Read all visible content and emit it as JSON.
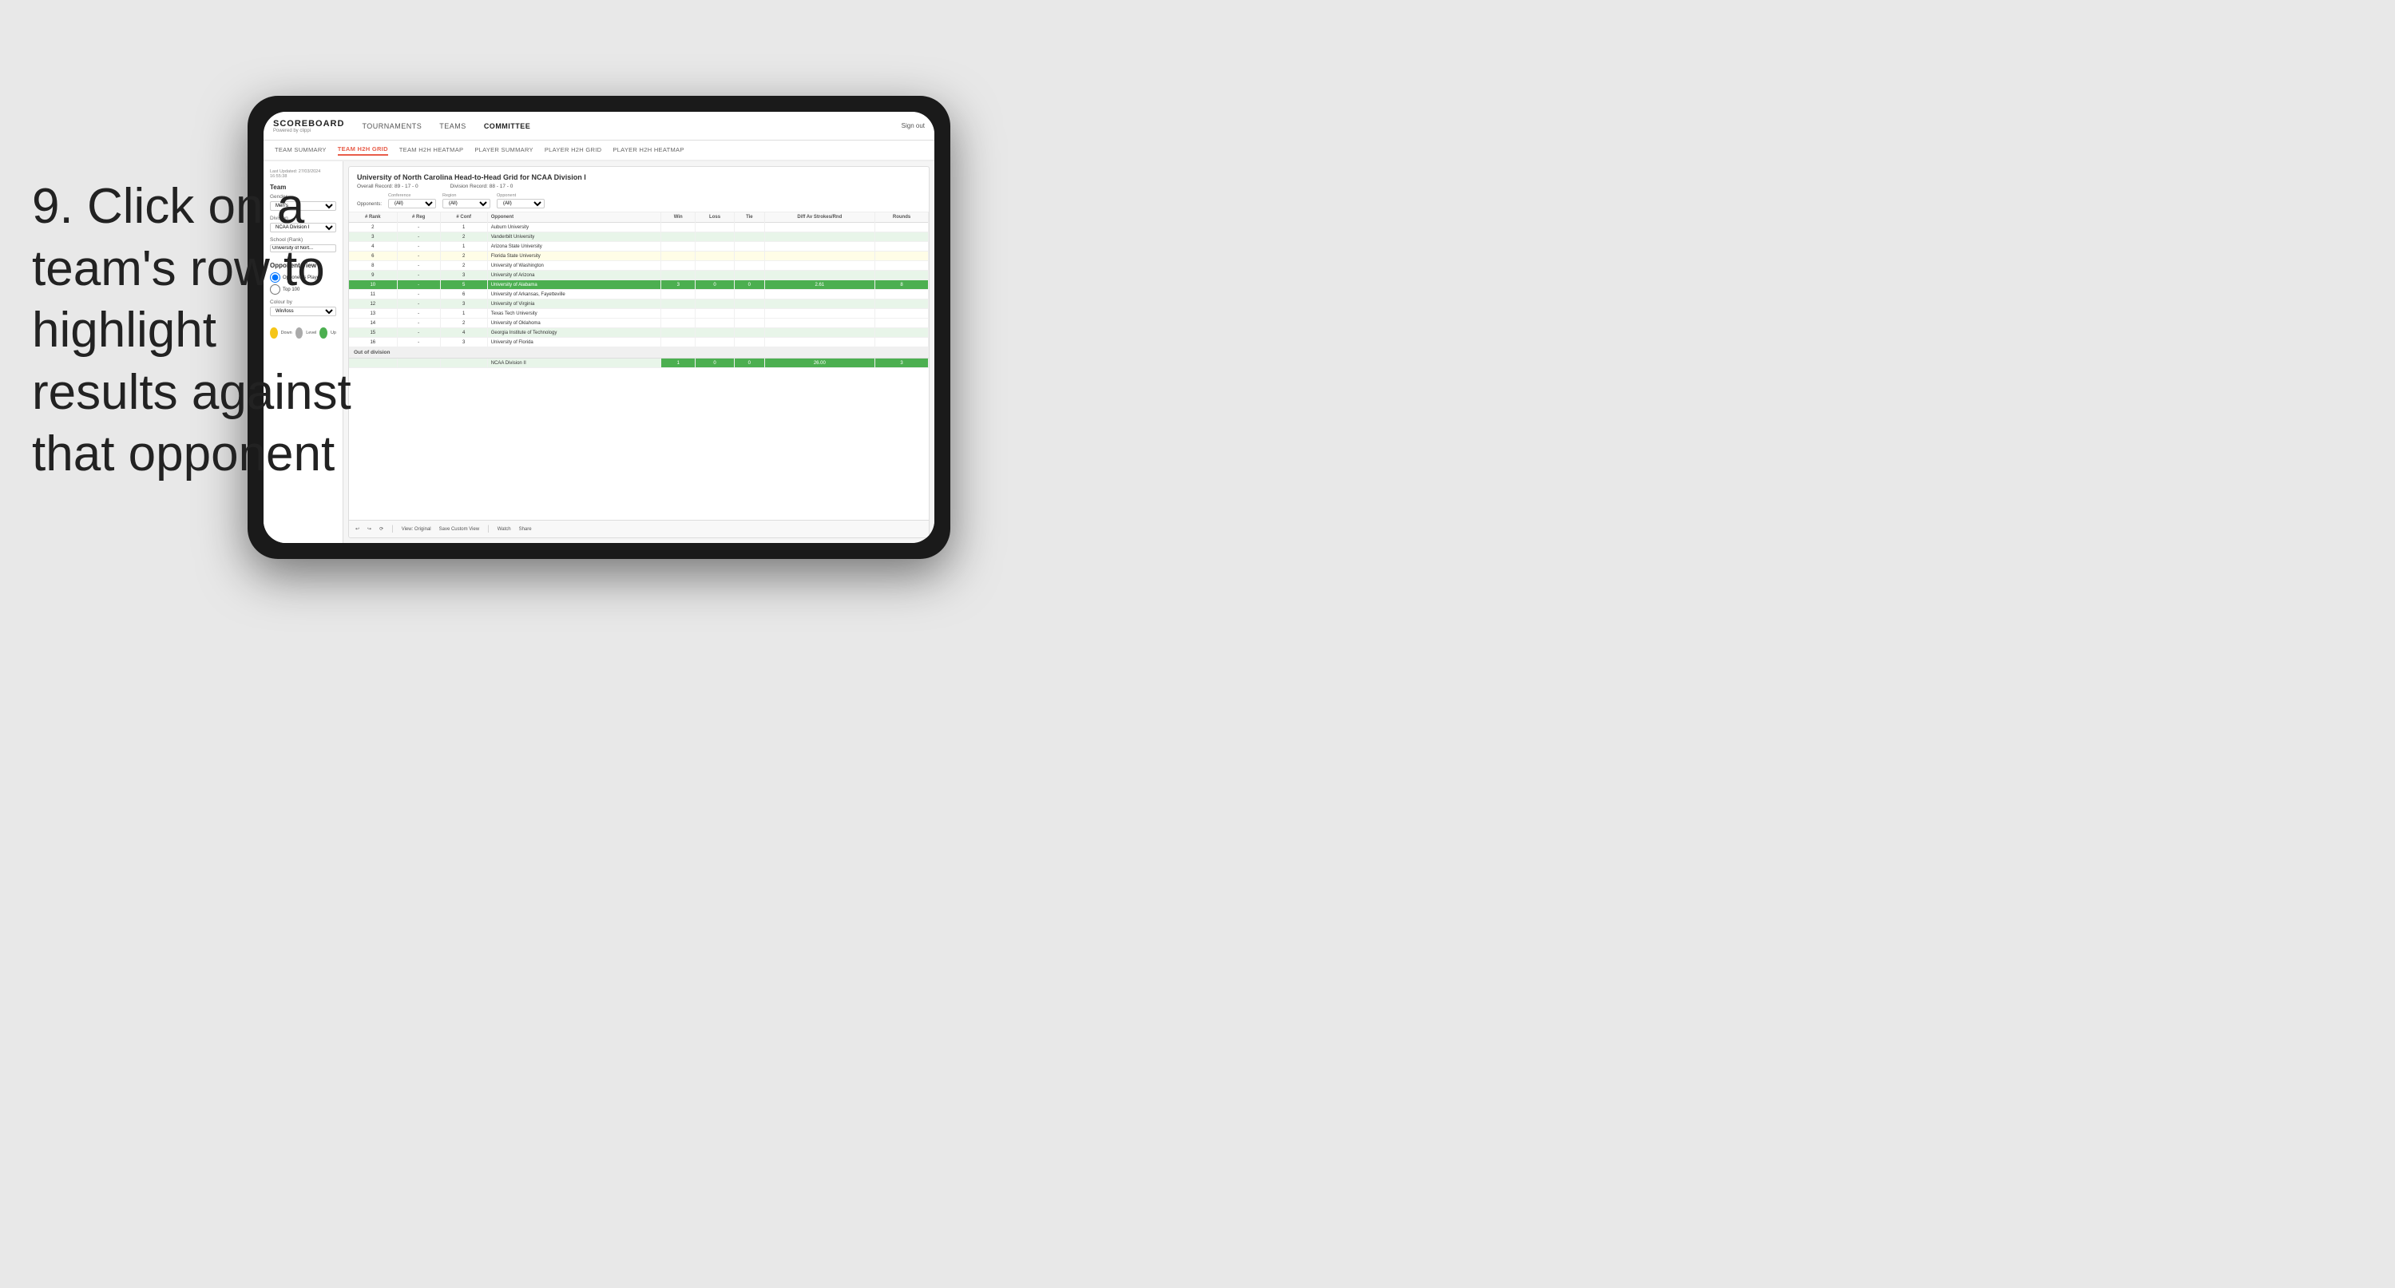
{
  "instruction": {
    "step": "9.",
    "text": "Click on a team's row to highlight results against that opponent"
  },
  "nav": {
    "logo": "SCOREBOARD",
    "logo_sub": "Powered by clippi",
    "items": [
      "TOURNAMENTS",
      "TEAMS",
      "COMMITTEE"
    ],
    "sign_out": "Sign out"
  },
  "sub_nav": {
    "items": [
      "TEAM SUMMARY",
      "TEAM H2H GRID",
      "TEAM H2H HEATMAP",
      "PLAYER SUMMARY",
      "PLAYER H2H GRID",
      "PLAYER H2H HEATMAP"
    ],
    "active": "TEAM H2H GRID"
  },
  "sidebar": {
    "last_updated_label": "Last Updated: 27/03/2024",
    "last_updated_time": "16:55:38",
    "team_label": "Team",
    "gender_label": "Gender",
    "gender_value": "Men's",
    "division_label": "Division",
    "division_value": "NCAA Division I",
    "school_label": "School (Rank)",
    "school_value": "University of Nort...",
    "opponent_view_label": "Opponent View",
    "radio_opponents": "Opponents Played",
    "radio_top100": "Top 100",
    "colour_by_label": "Colour by",
    "colour_value": "Win/loss",
    "legend_down": "Down",
    "legend_level": "Level",
    "legend_up": "Up"
  },
  "table": {
    "title": "University of North Carolina Head-to-Head Grid for NCAA Division I",
    "overall_record_label": "Overall Record:",
    "overall_record": "89 - 17 - 0",
    "division_record_label": "Division Record:",
    "division_record": "88 - 17 - 0",
    "filter_opponents_label": "Opponents:",
    "filter_conference_label": "Conference",
    "filter_conference_value": "(All)",
    "filter_region_label": "Region",
    "filter_region_value": "(All)",
    "filter_opponent_label": "Opponent",
    "filter_opponent_value": "(All)",
    "columns": {
      "rank": "# Rank",
      "reg": "# Reg",
      "conf": "# Conf",
      "opponent": "Opponent",
      "win": "Win",
      "loss": "Loss",
      "tie": "Tie",
      "diff_av": "Diff Av Strokes/Rnd",
      "rounds": "Rounds"
    },
    "rows": [
      {
        "rank": "2",
        "reg": "-",
        "conf": "1",
        "opponent": "Auburn University",
        "win": "",
        "loss": "",
        "tie": "",
        "diff": "",
        "rounds": "",
        "style": "normal"
      },
      {
        "rank": "3",
        "reg": "-",
        "conf": "2",
        "opponent": "Vanderbilt University",
        "win": "",
        "loss": "",
        "tie": "",
        "diff": "",
        "rounds": "",
        "style": "light-green"
      },
      {
        "rank": "4",
        "reg": "-",
        "conf": "1",
        "opponent": "Arizona State University",
        "win": "",
        "loss": "",
        "tie": "",
        "diff": "",
        "rounds": "",
        "style": "normal"
      },
      {
        "rank": "6",
        "reg": "-",
        "conf": "2",
        "opponent": "Florida State University",
        "win": "",
        "loss": "",
        "tie": "",
        "diff": "",
        "rounds": "",
        "style": "light-yellow"
      },
      {
        "rank": "8",
        "reg": "-",
        "conf": "2",
        "opponent": "University of Washington",
        "win": "",
        "loss": "",
        "tie": "",
        "diff": "",
        "rounds": "",
        "style": "normal"
      },
      {
        "rank": "9",
        "reg": "-",
        "conf": "3",
        "opponent": "University of Arizona",
        "win": "",
        "loss": "",
        "tie": "",
        "diff": "",
        "rounds": "",
        "style": "light-green"
      },
      {
        "rank": "10",
        "reg": "-",
        "conf": "5",
        "opponent": "University of Alabama",
        "win": "3",
        "loss": "0",
        "tie": "0",
        "diff": "2.61",
        "rounds": "8",
        "style": "highlighted"
      },
      {
        "rank": "11",
        "reg": "-",
        "conf": "6",
        "opponent": "University of Arkansas, Fayetteville",
        "win": "",
        "loss": "",
        "tie": "",
        "diff": "",
        "rounds": "",
        "style": "normal"
      },
      {
        "rank": "12",
        "reg": "-",
        "conf": "3",
        "opponent": "University of Virginia",
        "win": "",
        "loss": "",
        "tie": "",
        "diff": "",
        "rounds": "",
        "style": "light-green"
      },
      {
        "rank": "13",
        "reg": "-",
        "conf": "1",
        "opponent": "Texas Tech University",
        "win": "",
        "loss": "",
        "tie": "",
        "diff": "",
        "rounds": "",
        "style": "normal"
      },
      {
        "rank": "14",
        "reg": "-",
        "conf": "2",
        "opponent": "University of Oklahoma",
        "win": "",
        "loss": "",
        "tie": "",
        "diff": "",
        "rounds": "",
        "style": "normal"
      },
      {
        "rank": "15",
        "reg": "-",
        "conf": "4",
        "opponent": "Georgia Institute of Technology",
        "win": "",
        "loss": "",
        "tie": "",
        "diff": "",
        "rounds": "",
        "style": "light-green"
      },
      {
        "rank": "16",
        "reg": "-",
        "conf": "3",
        "opponent": "University of Florida",
        "win": "",
        "loss": "",
        "tie": "",
        "diff": "",
        "rounds": "",
        "style": "normal"
      }
    ],
    "out_of_division_label": "Out of division",
    "out_of_division_row": {
      "division": "NCAA Division II",
      "win": "1",
      "loss": "0",
      "tie": "0",
      "diff": "26.00",
      "rounds": "3"
    }
  },
  "toolbar": {
    "view_original": "View: Original",
    "save_custom": "Save Custom View",
    "watch": "Watch",
    "share": "Share"
  },
  "colors": {
    "highlighted_green": "#4caf50",
    "light_green": "#e8f5e9",
    "light_yellow": "#fffde7",
    "active_tab": "#e85d4a",
    "dot_down": "#f5c518",
    "dot_level": "#aaa",
    "dot_up": "#4caf50"
  }
}
